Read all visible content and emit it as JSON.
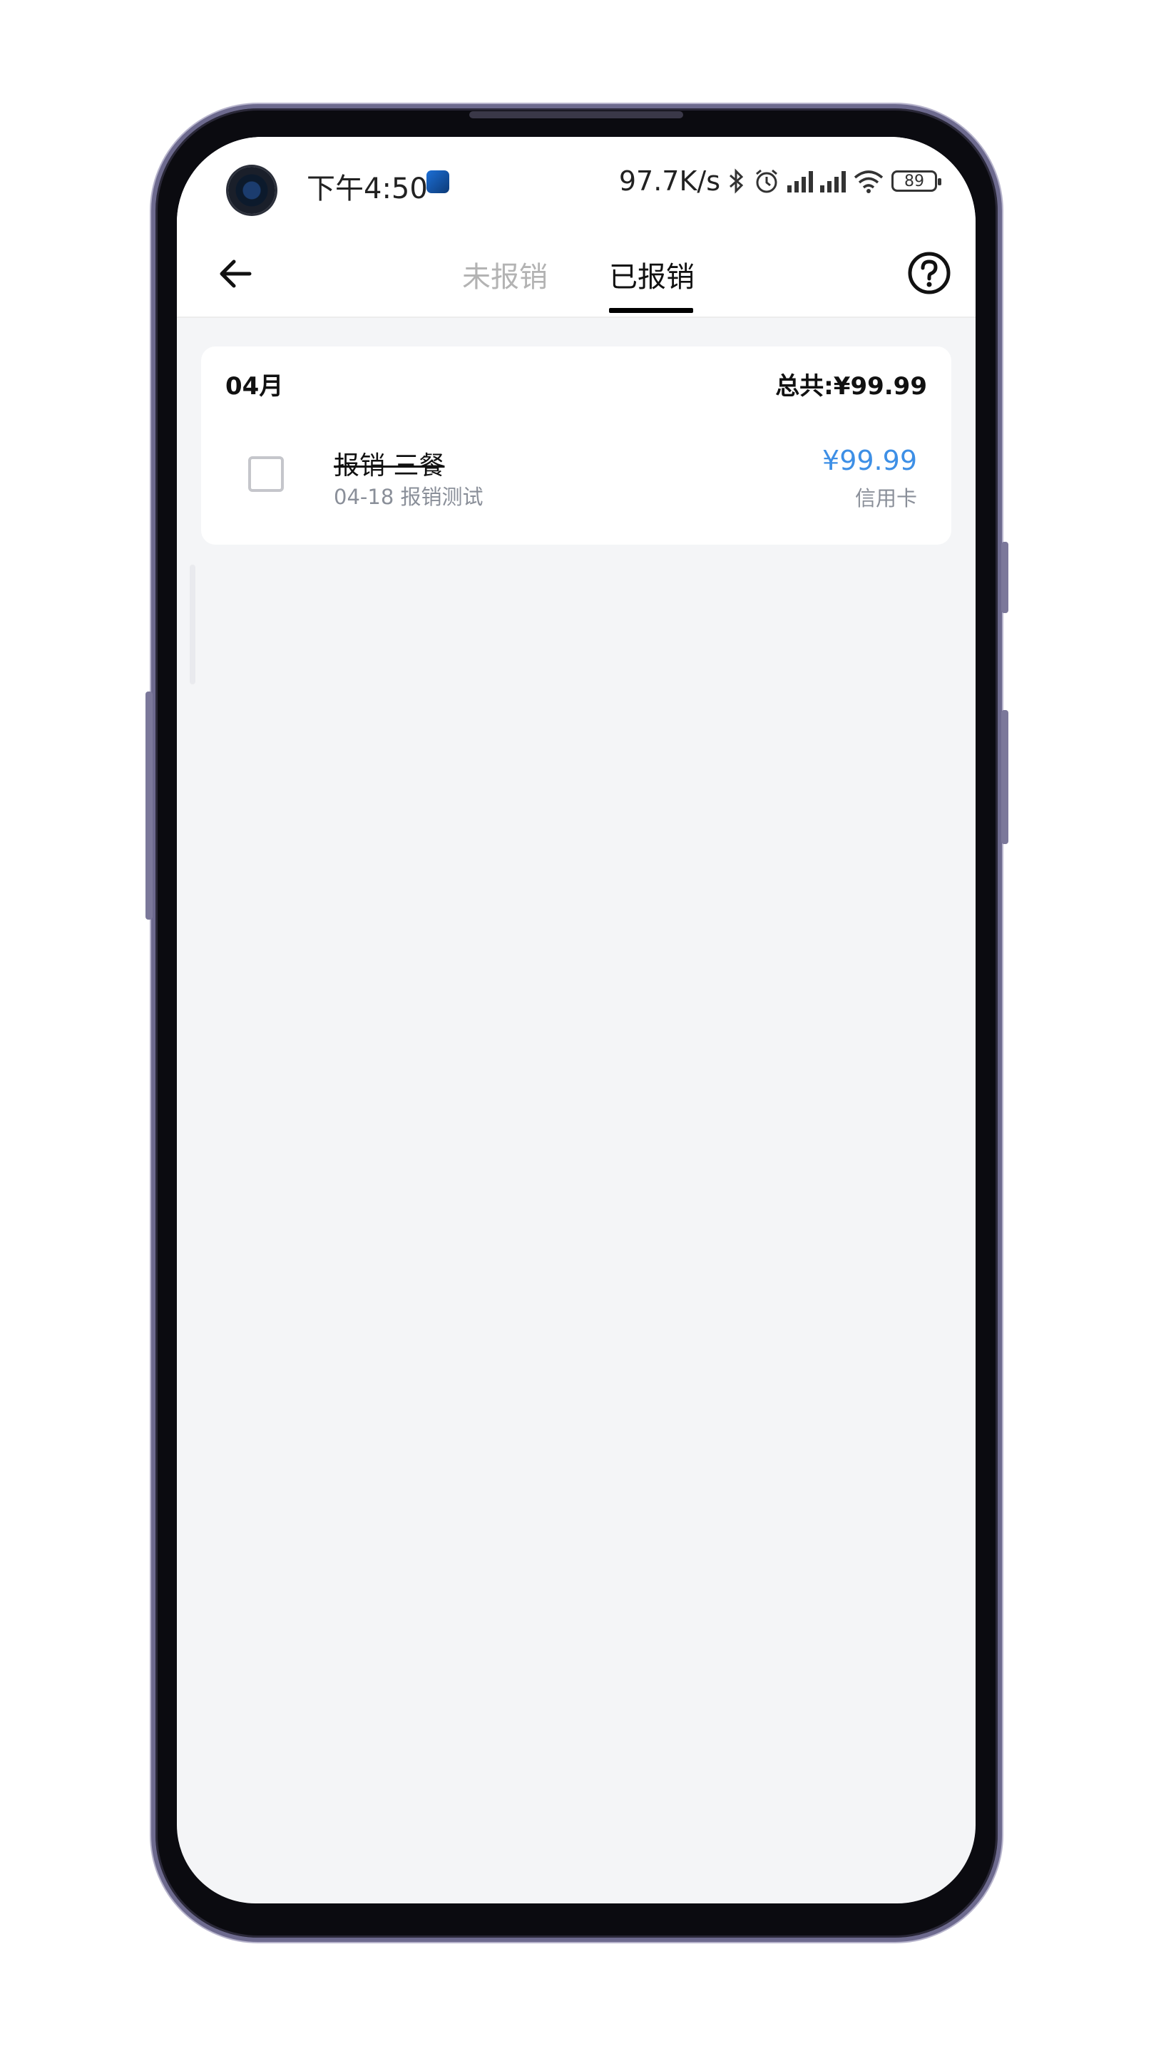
{
  "status_bar": {
    "time": "下午4:50",
    "net_speed": "97.7K/s",
    "battery": "89"
  },
  "nav": {
    "tabs": [
      {
        "label": "未报销",
        "active": false
      },
      {
        "label": "已报销",
        "active": true
      }
    ]
  },
  "group": {
    "month": "04月",
    "total": "总共:¥99.99",
    "items": [
      {
        "title": "报销 三餐",
        "subtitle": "04-18 报销测试",
        "amount": "¥99.99",
        "method": "信用卡",
        "checked": false
      }
    ]
  },
  "colors": {
    "accent": "#3d8fe6",
    "background": "#f4f5f7"
  }
}
